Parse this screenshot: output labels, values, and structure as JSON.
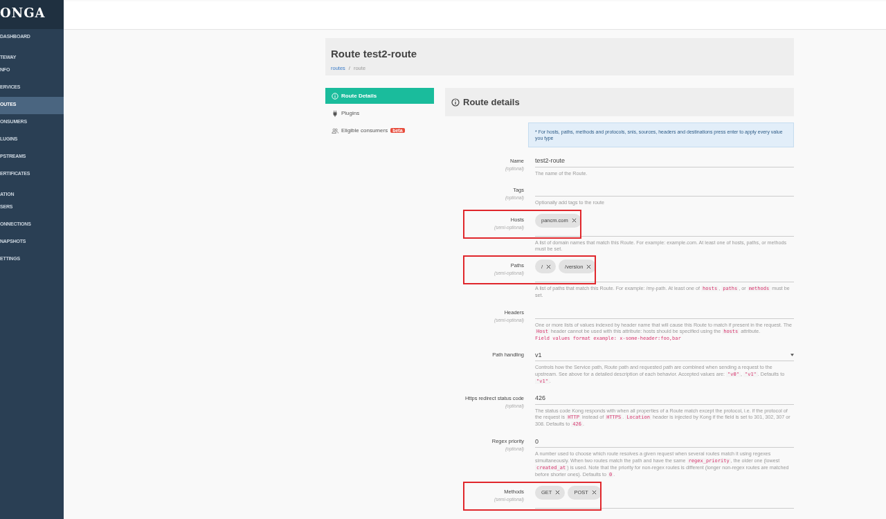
{
  "sidebar": {
    "logo": "ONGA",
    "items": [
      {
        "label": "DASHBOARD",
        "kind": "link",
        "selected": false
      },
      {
        "label": "TEWAY",
        "kind": "section"
      },
      {
        "label": "NFO",
        "kind": "link",
        "selected": false
      },
      {
        "label": "ERVICES",
        "kind": "link",
        "selected": false
      },
      {
        "label": "OUTES",
        "kind": "link",
        "selected": true
      },
      {
        "label": "ONSUMERS",
        "kind": "link",
        "selected": false
      },
      {
        "label": "LUGINS",
        "kind": "link",
        "selected": false
      },
      {
        "label": "PSTREAMS",
        "kind": "link",
        "selected": false
      },
      {
        "label": "ERTIFICATES",
        "kind": "link",
        "selected": false
      },
      {
        "label": "ATION",
        "kind": "section"
      },
      {
        "label": "SERS",
        "kind": "link",
        "selected": false
      },
      {
        "label": "ONNECTIONS",
        "kind": "link",
        "selected": false
      },
      {
        "label": "NAPSHOTS",
        "kind": "link",
        "selected": false
      },
      {
        "label": "ETTINGS",
        "kind": "link",
        "selected": false
      }
    ]
  },
  "header": {
    "title": "Route test2-route",
    "separator": "/",
    "breadcrumb": [
      {
        "label": "routes",
        "kind": "link"
      },
      {
        "label": "route",
        "kind": "current"
      }
    ]
  },
  "tabs": [
    {
      "label": "Route Details",
      "selected": true
    },
    {
      "label": "Plugins",
      "selected": false
    },
    {
      "label": "Eligible consumers",
      "badge": "beta",
      "selected": false
    }
  ],
  "panel": {
    "title": "Route details",
    "notice": "* For hosts, paths, methods and protocols, snis, sources, headers and destinations press enter to apply every value you type"
  },
  "fields": [
    {
      "label": "Name",
      "note": "(optional)",
      "kind": "text",
      "value": "test2-route",
      "highlighted": false,
      "help": [
        {
          "text": "The name of the Route.",
          "kind": "text"
        }
      ]
    },
    {
      "label": "Tags",
      "note": "(optional)",
      "kind": "tags",
      "highlighted": false,
      "help": [
        {
          "text": "Optionally add tags to the route",
          "kind": "text"
        }
      ]
    },
    {
      "label": "Hosts",
      "note": "(semi-optional)",
      "kind": "tags",
      "chips": [
        "pancm.com"
      ],
      "highlighted": true,
      "help": [
        {
          "text": "A list of domain names that match this Route. For example: example.com. At least one of hosts, paths, or methods must be set.",
          "kind": "text"
        }
      ]
    },
    {
      "label": "Paths",
      "note": "(semi-optional)",
      "kind": "tags",
      "chips": [
        "/",
        "/version"
      ],
      "highlighted": true,
      "help": [
        {
          "text": "A list of paths that match this Route. For example: /my-path. At least one of ",
          "kind": "text"
        },
        {
          "text": "hosts",
          "kind": "code"
        },
        {
          "text": ", ",
          "kind": "text"
        },
        {
          "text": "paths",
          "kind": "code"
        },
        {
          "text": ", or ",
          "kind": "text"
        },
        {
          "text": "methods",
          "kind": "code"
        },
        {
          "text": " must be set.",
          "kind": "text"
        }
      ]
    },
    {
      "label": "Headers",
      "note": "(semi-optional)",
      "kind": "tags",
      "highlighted": false,
      "help": [
        {
          "text": "One or more lists of values indexed by header name that will cause this Route to match if present in the request. The ",
          "kind": "text"
        },
        {
          "text": "Host",
          "kind": "code"
        },
        {
          "text": " header cannot be used with this attribute: hosts should be specified using the ",
          "kind": "text"
        },
        {
          "text": "hosts",
          "kind": "code"
        },
        {
          "text": " attribute.",
          "kind": "text"
        }
      ],
      "example": "Field values format example: x-some-header:foo,bar"
    },
    {
      "label": "Path handling",
      "kind": "select",
      "value": "v1",
      "highlighted": false,
      "help": [
        {
          "text": "Controls how the Service path, Route path and requested path are combined when sending a request to the upstream. See above for a detailed description of each behavior. Accepted values are: ",
          "kind": "text"
        },
        {
          "text": "\"v0\"",
          "kind": "code"
        },
        {
          "text": ", ",
          "kind": "text"
        },
        {
          "text": "\"v1\"",
          "kind": "code"
        },
        {
          "text": ". Defaults to ",
          "kind": "text"
        },
        {
          "text": "\"v1\"",
          "kind": "code"
        },
        {
          "text": ".",
          "kind": "text"
        }
      ]
    },
    {
      "label": "Https redirect status code",
      "note": "(optional)",
      "kind": "text",
      "value": "426",
      "highlighted": false,
      "help": [
        {
          "text": "The status code Kong responds with when all properties of a Route match except the protocol, i.e. if the protocol of the request is ",
          "kind": "text"
        },
        {
          "text": "HTTP",
          "kind": "code"
        },
        {
          "text": " instead of ",
          "kind": "text"
        },
        {
          "text": "HTTPS",
          "kind": "code"
        },
        {
          "text": ". ",
          "kind": "text"
        },
        {
          "text": "Location",
          "kind": "code"
        },
        {
          "text": " header is injected by Kong if the field is set to 301, 302, 307 or 308. Defaults to ",
          "kind": "text"
        },
        {
          "text": "426",
          "kind": "code"
        },
        {
          "text": ".",
          "kind": "text"
        }
      ]
    },
    {
      "label": "Regex priority",
      "note": "(optional)",
      "kind": "text",
      "value": "0",
      "highlighted": false,
      "help": [
        {
          "text": "A number used to choose which route resolves a given request when several routes match it using regexes simultaneously. When two routes match the path and have the same ",
          "kind": "text"
        },
        {
          "text": "regex_priority",
          "kind": "code"
        },
        {
          "text": ", the older one (lowest ",
          "kind": "text"
        },
        {
          "text": "created_at",
          "kind": "code"
        },
        {
          "text": ") is used. Note that the priority for non-regex routes is different (longer non-regex routes are matched before shorter ones). Defaults to ",
          "kind": "text"
        },
        {
          "text": "0",
          "kind": "code"
        },
        {
          "text": ".",
          "kind": "text"
        }
      ]
    },
    {
      "label": "Methods",
      "note": "(semi-optional)",
      "kind": "tags",
      "chips": [
        "GET",
        "POST"
      ],
      "highlighted": true
    }
  ]
}
